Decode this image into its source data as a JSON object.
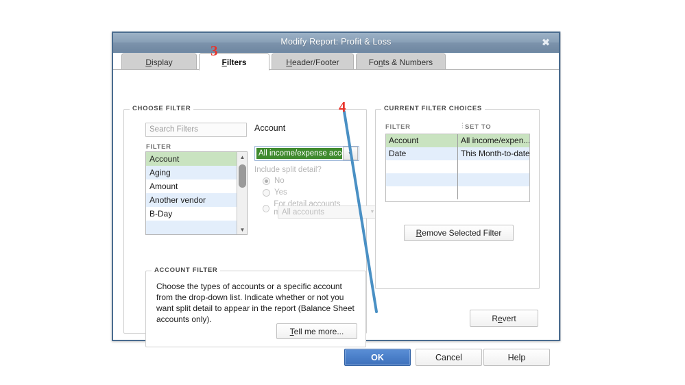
{
  "dialog": {
    "title": "Modify Report: Profit & Loss",
    "close_icon": "close-icon"
  },
  "tabs": [
    {
      "label": "Display",
      "accel": "D",
      "active": false
    },
    {
      "label": "Filters",
      "accel": "F",
      "active": true
    },
    {
      "label": "Header/Footer",
      "accel": "H",
      "active": false
    },
    {
      "label": "Fonts & Numbers",
      "accel": "n",
      "active": false
    }
  ],
  "choose_filter": {
    "group_label": "CHOOSE FILTER",
    "search_placeholder": "Search Filters",
    "search_value": "",
    "list_column_header": "FILTER",
    "items": [
      {
        "label": "Account",
        "selected": true
      },
      {
        "label": "Aging",
        "selected": false
      },
      {
        "label": "Amount",
        "selected": false
      },
      {
        "label": "Another vendor",
        "selected": false
      },
      {
        "label": "B-Day",
        "selected": false
      },
      {
        "label": "",
        "selected": false
      }
    ],
    "scroll_up_icon": "triangle-up-icon",
    "scroll_down_icon": "triangle-down-icon"
  },
  "account_pane": {
    "heading": "Account",
    "combo_value": "All income/expense accounts",
    "combo_arrow_icon": "chevron-down-icon",
    "split_question": "Include split detail?",
    "radios": [
      {
        "label": "No",
        "checked": true
      },
      {
        "label": "Yes",
        "checked": false
      },
      {
        "label": "For detail accounts matching",
        "checked": false
      }
    ],
    "accounts_combo_value": "All accounts",
    "accounts_combo_arrow_icon": "chevron-down-icon"
  },
  "account_filter": {
    "group_label": "ACCOUNT FILTER",
    "description": "Choose the types of accounts or a specific account from the drop-down list. Indicate whether or not you want split detail to appear in the report (Balance Sheet accounts only).",
    "tell_me_more_label": "Tell me more...",
    "tell_me_more_accel": "T"
  },
  "current_filter_choices": {
    "group_label": "CURRENT FILTER CHOICES",
    "columns": [
      "FILTER",
      "SET TO"
    ],
    "column_divider_icon": "vertical-dots-icon",
    "rows": [
      {
        "filter": "Account",
        "set_to": "All income/expen...",
        "selected": true
      },
      {
        "filter": "Date",
        "set_to": "This Month-to-date",
        "selected": false
      },
      {
        "filter": "",
        "set_to": "",
        "selected": false
      },
      {
        "filter": "",
        "set_to": "",
        "selected": false
      },
      {
        "filter": "",
        "set_to": "",
        "selected": false
      }
    ],
    "remove_button_label": "Remove Selected Filter",
    "remove_button_accel": "R"
  },
  "revert_button": {
    "label": "Revert",
    "accel": "e"
  },
  "footer_buttons": [
    {
      "label": "OK",
      "primary": true
    },
    {
      "label": "Cancel",
      "primary": false
    },
    {
      "label": "Help",
      "primary": false
    }
  ],
  "annotations": [
    {
      "number": "3",
      "target": "Filters tab"
    },
    {
      "number": "4",
      "target": "OK button"
    }
  ],
  "colors": {
    "annotation_red": "#e8332a",
    "annotation_arrow_blue": "#4a90c4",
    "selection_green": "#c9e3c0",
    "combo_highlight_green": "#3f8a2e",
    "row_stripe_blue": "#e3eefb",
    "titlebar_blue": "#7b92ab",
    "primary_button_blue": "#4a7fc9"
  }
}
